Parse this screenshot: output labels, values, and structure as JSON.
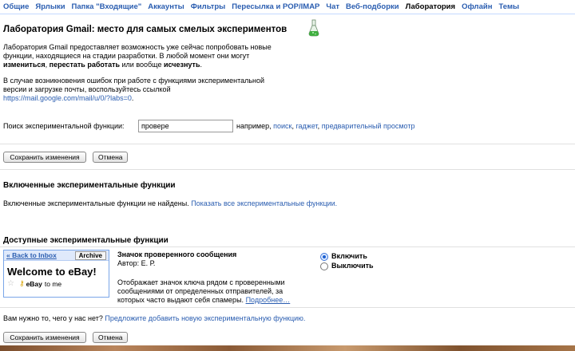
{
  "tabs": [
    {
      "label": "Общие",
      "active": false
    },
    {
      "label": "Ярлыки",
      "active": false
    },
    {
      "label": "Папка \"Входящие\"",
      "active": false
    },
    {
      "label": "Аккаунты",
      "active": false
    },
    {
      "label": "Фильтры",
      "active": false
    },
    {
      "label": "Пересылка и POP/IMAP",
      "active": false
    },
    {
      "label": "Чат",
      "active": false
    },
    {
      "label": "Веб-подборки",
      "active": false
    },
    {
      "label": "Лаборатория",
      "active": true
    },
    {
      "label": "Офлайн",
      "active": false
    },
    {
      "label": "Темы",
      "active": false
    }
  ],
  "header": {
    "title": "Лаборатория Gmail: место для самых смелых экспериментов",
    "intro_1": "Лаборатория Gmail предоставляет возможность уже сейчас попробовать новые",
    "intro_2": "функции, находящиеся на стадии разработки. В любой момент они могут",
    "intro_3_a": "измениться",
    "intro_3_b": ", ",
    "intro_3_c": "перестать работать",
    "intro_3_d": " или вообще ",
    "intro_3_e": "исчезнуть",
    "intro_3_f": ".",
    "error_1": "В случае возникновения ошибок при работе с функциями экспериментальной",
    "error_2": "версии и загрузке почты, воспользуйтесь ссылкой",
    "error_link": "https://mail.google.com/mail/u/0/?labs=0",
    "error_end": "."
  },
  "search": {
    "label": "Поиск экспериментальной функции:",
    "value": "провере",
    "example_prefix": "например,",
    "examples": [
      "поиск",
      "гаджет",
      "предварительный просмотр"
    ]
  },
  "buttons": {
    "save": "Сохранить изменения",
    "cancel": "Отмена"
  },
  "enabled": {
    "heading": "Включенные экспериментальные функции",
    "none_text": "Включенные экспериментальные функции не найдены.",
    "show_all": "Показать все экспериментальные функции."
  },
  "available": {
    "heading": "Доступные экспериментальные функции",
    "feature": {
      "name": "Значок проверенного сообщения",
      "author": "Автор: Е. Р.",
      "desc_1": "Отображает значок ключа рядом с проверенными",
      "desc_2": "сообщениями от определенных отправителей, за",
      "desc_3": "которых часто выдают себя спамеры.",
      "more": "Подробнее…",
      "preview": {
        "back": "« Back to Inbox",
        "archive": "Archive",
        "welcome": "Welcome to eBay!",
        "sender": "eBay",
        "to": "to me"
      },
      "options": {
        "enable": "Включить",
        "disable": "Выключить",
        "selected": "enable"
      }
    }
  },
  "suggest": {
    "question": "Вам нужно то, чего у нас нет?",
    "link": "Предложите добавить новую экспериментальную функцию."
  }
}
